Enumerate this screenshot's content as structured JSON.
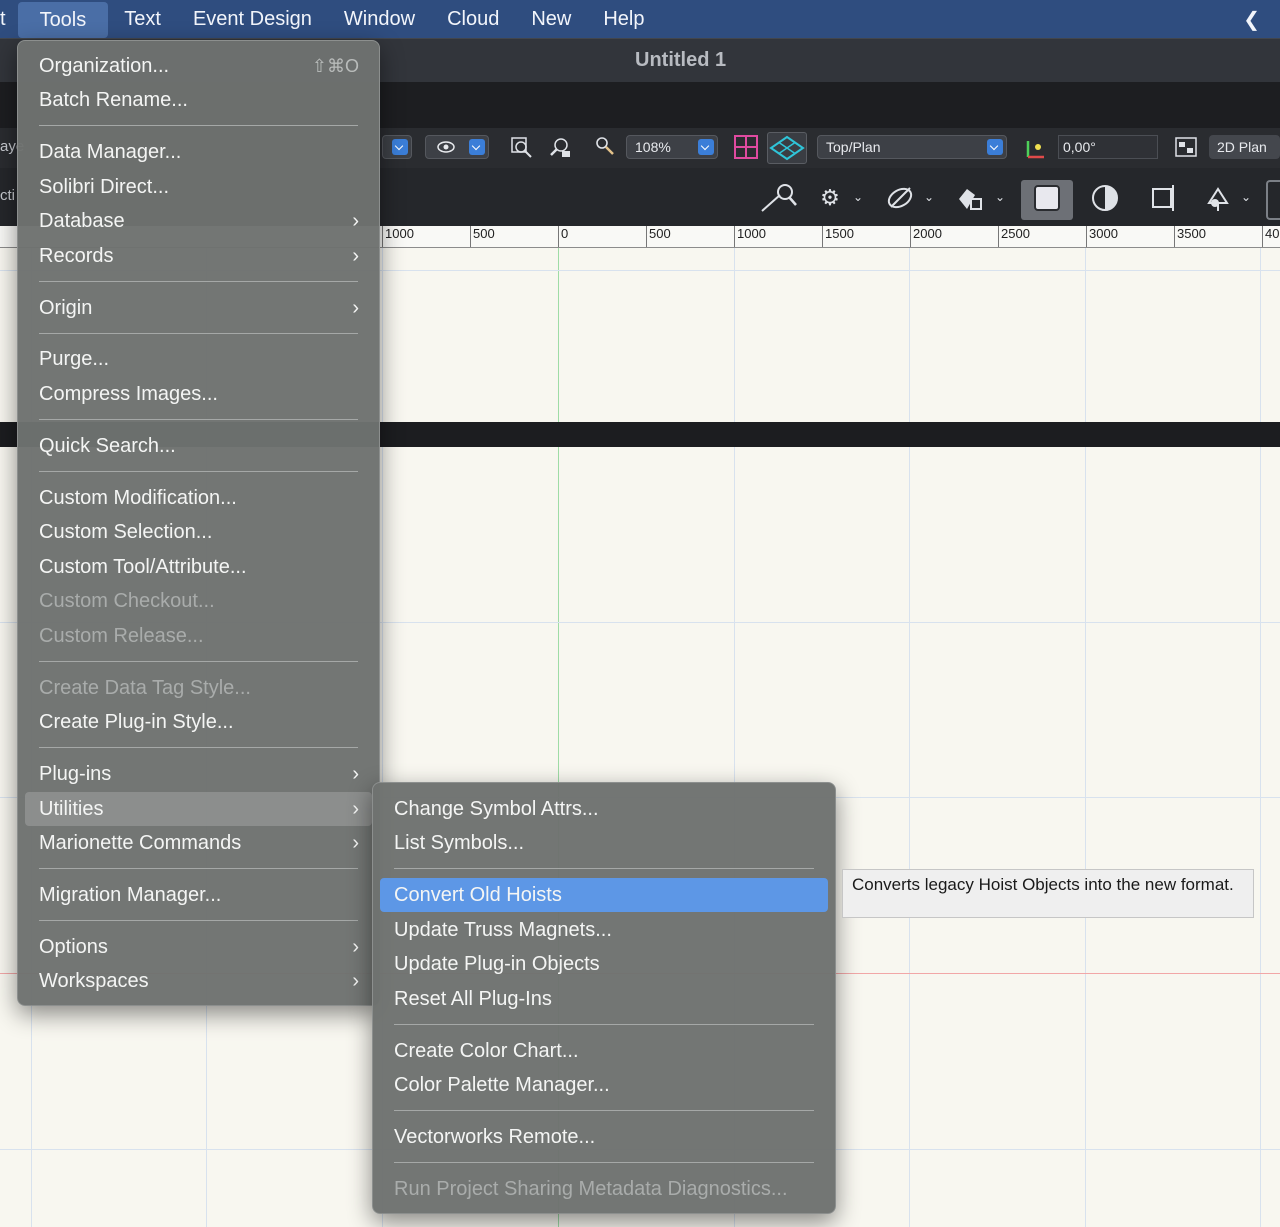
{
  "menubar": {
    "items": [
      "t",
      "Tools",
      "Text",
      "Event Design",
      "Window",
      "Cloud",
      "New",
      "Help"
    ],
    "active": "Tools",
    "collapse_glyph": "❮"
  },
  "window": {
    "title": "Untitled 1"
  },
  "toolbar": {
    "left_fragment_1": "aye",
    "left_fragment_2": "cti",
    "zoom": "108%",
    "view": "Top/Plan",
    "angle": "0,00°",
    "plan_mode": "2D Plan",
    "icons": [
      "visibility-icon",
      "zoom-fit-icon",
      "zoom-selection-icon",
      "magnifier-icon",
      "grid-view-icon",
      "isometric-view-icon",
      "axis-rotate-icon",
      "layout-icon"
    ],
    "tool_icons": [
      "selection-tool-icon",
      "gear-icon",
      "snap-icon",
      "shapes-icon",
      "fill-square-icon",
      "contrast-icon",
      "crop-icon",
      "reshape-icon"
    ]
  },
  "ruler": {
    "labels": [
      "1000",
      "500",
      "0",
      "500",
      "1000",
      "1500",
      "2000",
      "2500",
      "3000",
      "3500",
      "40"
    ]
  },
  "tools_menu": {
    "items": [
      {
        "label": "Organization...",
        "shortcut": "⇧⌘O"
      },
      {
        "label": "Batch Rename..."
      },
      {
        "label": "Data Manager..."
      },
      {
        "label": "Solibri Direct..."
      },
      {
        "label": "Database",
        "submenu": true
      },
      {
        "label": "Records",
        "submenu": true
      },
      {
        "label": "Origin",
        "submenu": true
      },
      {
        "label": "Purge..."
      },
      {
        "label": "Compress Images..."
      },
      {
        "label": "Quick Search..."
      },
      {
        "label": "Custom Modification..."
      },
      {
        "label": "Custom Selection..."
      },
      {
        "label": "Custom Tool/Attribute..."
      },
      {
        "label": "Custom Checkout...",
        "disabled": true
      },
      {
        "label": "Custom Release...",
        "disabled": true
      },
      {
        "label": "Create Data Tag Style...",
        "disabled": true
      },
      {
        "label": "Create Plug-in Style..."
      },
      {
        "label": "Plug-ins",
        "submenu": true
      },
      {
        "label": "Utilities",
        "submenu": true,
        "highlighted": true
      },
      {
        "label": "Marionette Commands",
        "submenu": true
      },
      {
        "label": "Migration Manager..."
      },
      {
        "label": "Options",
        "submenu": true
      },
      {
        "label": "Workspaces",
        "submenu": true
      }
    ],
    "arrow_glyph": "›"
  },
  "utilities_menu": {
    "items": [
      {
        "label": "Change Symbol Attrs..."
      },
      {
        "label": "List Symbols..."
      },
      {
        "label": "Convert Old Hoists",
        "highlighted": true
      },
      {
        "label": "Update Truss Magnets..."
      },
      {
        "label": "Update Plug-in Objects"
      },
      {
        "label": "Reset All Plug-Ins"
      },
      {
        "label": "Create Color Chart..."
      },
      {
        "label": "Color Palette Manager..."
      },
      {
        "label": "Vectorworks Remote..."
      },
      {
        "label": "Run Project Sharing Metadata Diagnostics...",
        "disabled": true
      }
    ]
  },
  "tooltip": {
    "text": "Converts legacy Hoist Objects into the new format."
  },
  "colors": {
    "menubar": "#2f4d7f",
    "menu_bg": "#6e7270",
    "highlight_blue": "#5d97e6",
    "canvas": "#f8f7f0"
  }
}
